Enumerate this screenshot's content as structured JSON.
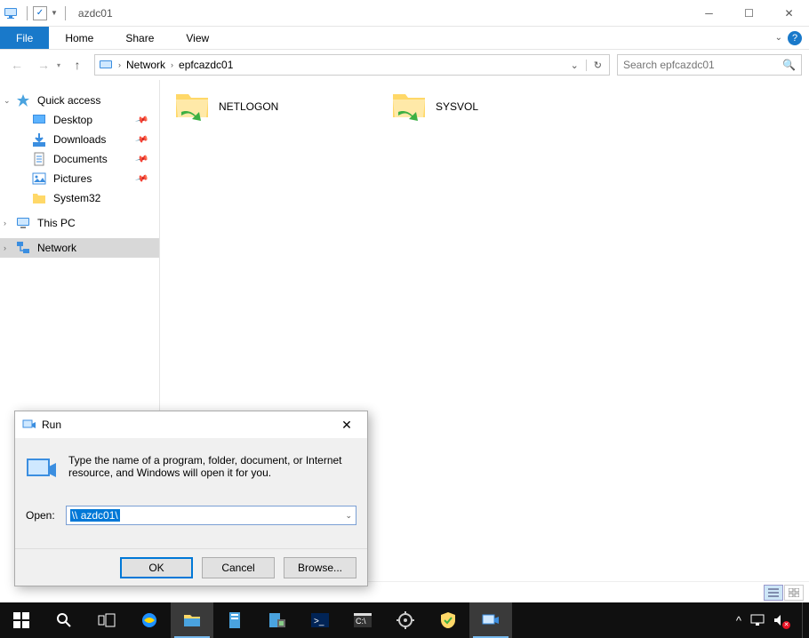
{
  "title": "azdc01",
  "ribbon": {
    "file": "File",
    "home": "Home",
    "share": "Share",
    "view": "View"
  },
  "breadcrumb": {
    "root": "Network",
    "location": "epfcazdc01"
  },
  "search": {
    "placeholder": "Search epfcazdc01"
  },
  "sidebar": {
    "quick_access": "Quick access",
    "desktop": "Desktop",
    "downloads": "Downloads",
    "documents": "Documents",
    "pictures": "Pictures",
    "system32": "System32",
    "this_pc": "This PC",
    "network": "Network"
  },
  "folders": {
    "netlogon": "NETLOGON",
    "sysvol": "SYSVOL"
  },
  "run": {
    "title": "Run",
    "instruction": "Type the name of a program, folder, document, or Internet resource, and Windows will open it for you.",
    "open_label": "Open:",
    "input_value": "\\\\    azdc01\\",
    "ok": "OK",
    "cancel": "Cancel",
    "browse": "Browse..."
  }
}
